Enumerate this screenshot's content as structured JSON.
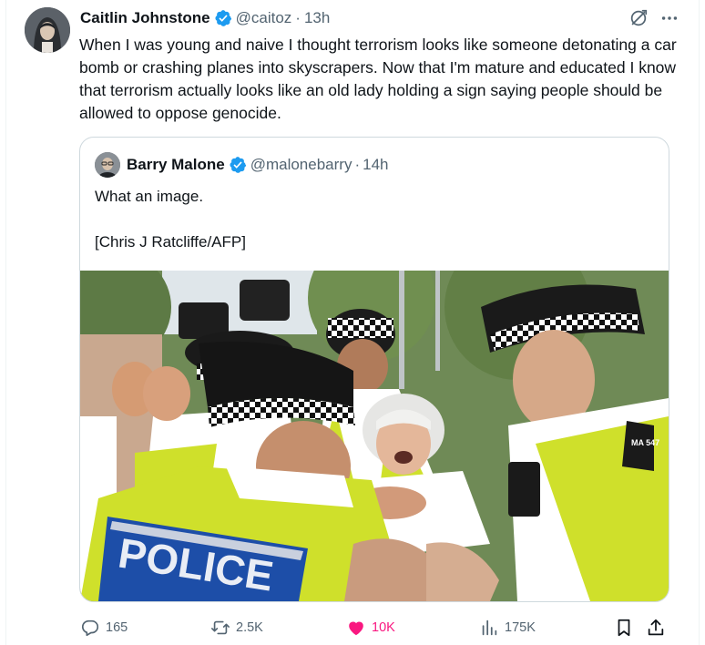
{
  "tweet": {
    "author_name": "Caitlin Johnstone",
    "handle": "@caitoz",
    "separator": "·",
    "time": "13h",
    "text": "When I was young and naive I thought terrorism looks like someone detonating a car bomb or crashing planes into skyscrapers. Now that I'm mature and educated I know that terrorism actually looks like an old lady holding a sign saying people should be allowed to oppose genocide.",
    "icons": [
      "grok-icon",
      "more-icon",
      "verified-badge-icon"
    ]
  },
  "quote": {
    "author_name": "Barry Malone",
    "handle": "@malonebarry",
    "separator": "·",
    "time": "14h",
    "text_line1": "What an image.",
    "text_line2": "[Chris J Ratcliffe/AFP]",
    "photo": {
      "vest_text": "POLICE",
      "shoulder_text": "MA 547"
    }
  },
  "actions": {
    "replies": "165",
    "reposts": "2.5K",
    "likes": "10K",
    "views": "175K",
    "like_color": "#f91880",
    "icons": [
      "reply-icon",
      "repost-icon",
      "like-icon",
      "views-icon",
      "bookmark-icon",
      "share-icon"
    ]
  },
  "colors": {
    "verified": "#1d9bf0",
    "muted": "#536471",
    "text": "#0f1419",
    "border": "#cfd9de"
  }
}
